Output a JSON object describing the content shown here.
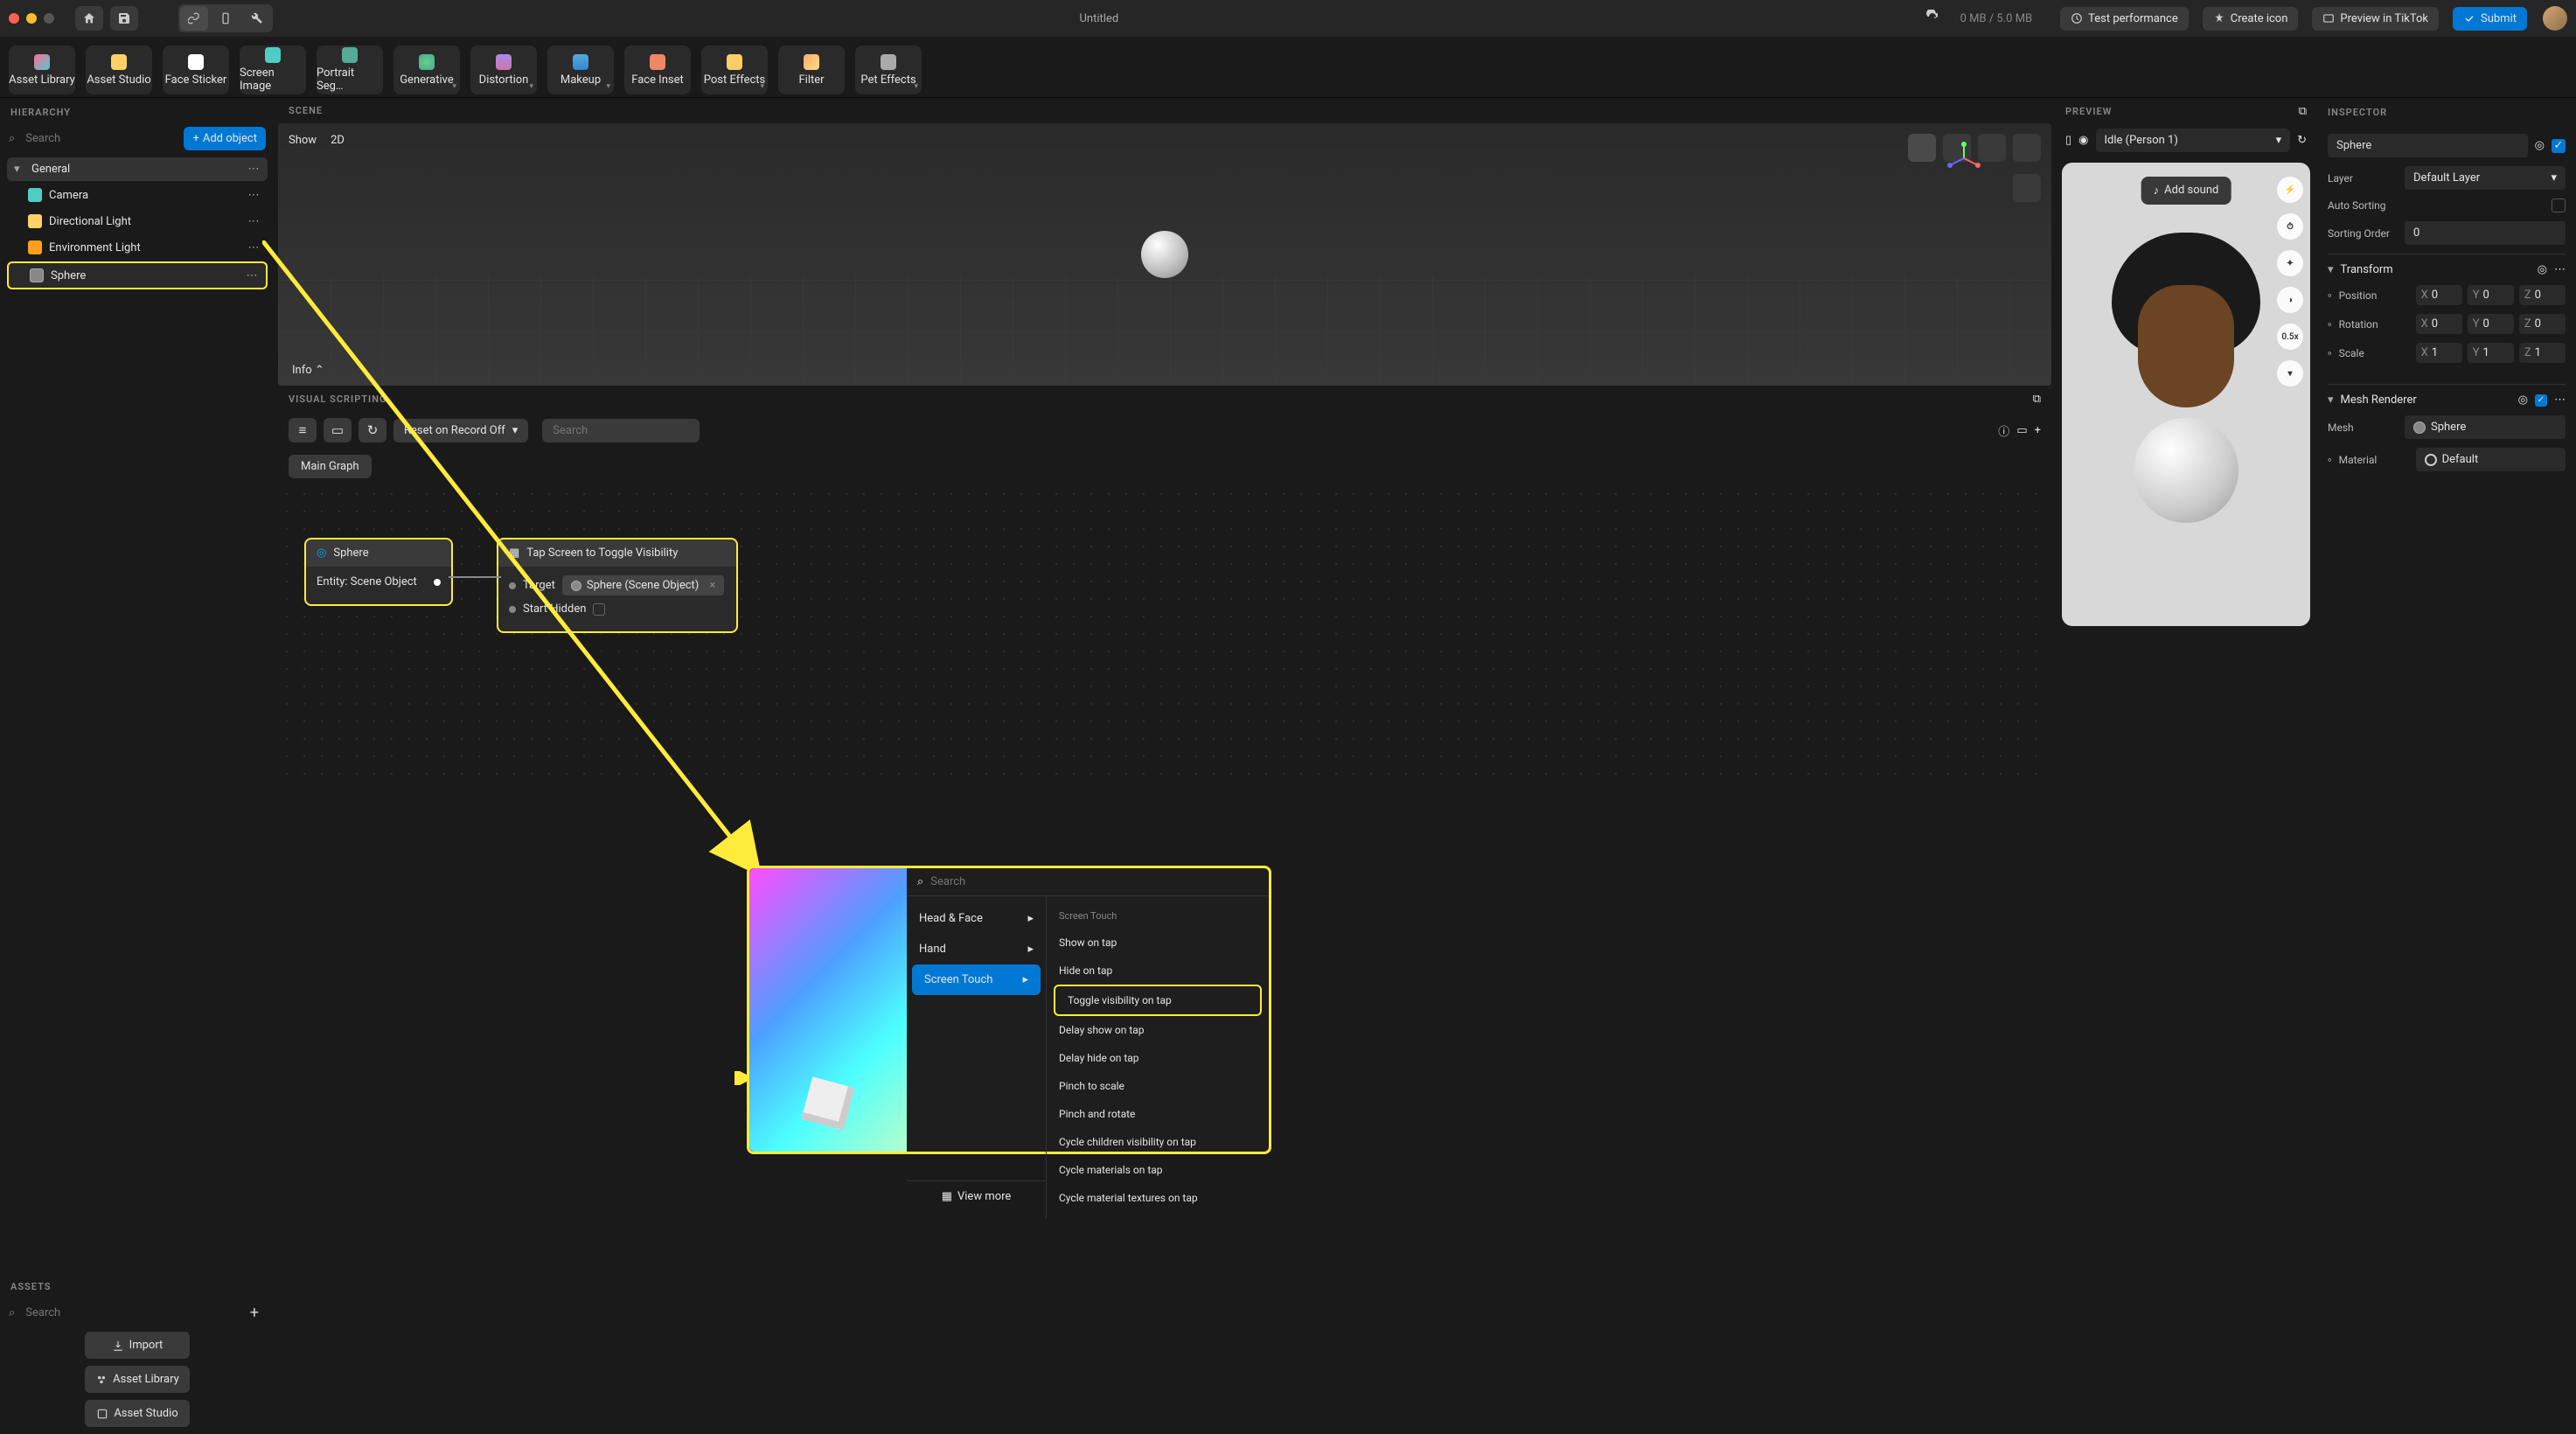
{
  "topbar": {
    "title": "Untitled",
    "size": "0 MB / 5.0 MB",
    "test_perf": "Test performance",
    "create_icon": "Create icon",
    "preview_tiktok": "Preview in TikTok",
    "submit": "Submit"
  },
  "toolbar": {
    "items": [
      "Asset Library",
      "Asset Studio",
      "Face Sticker",
      "Screen Image",
      "Portrait Seg…",
      "Generative",
      "Distortion",
      "Makeup",
      "Face Inset",
      "Post Effects",
      "Filter",
      "Pet Effects"
    ]
  },
  "hierarchy": {
    "title": "HIERARCHY",
    "search": "Search",
    "add_object": "Add object",
    "root": "General",
    "items": [
      "Camera",
      "Directional Light",
      "Environment Light",
      "Sphere"
    ]
  },
  "assets": {
    "title": "ASSETS",
    "search": "Search",
    "import": "Import",
    "library": "Asset Library",
    "studio": "Asset Studio"
  },
  "scene": {
    "title": "SCENE",
    "show": "Show",
    "mode": "2D",
    "info": "Info"
  },
  "visual_scripting": {
    "title": "VISUAL SCRIPTING",
    "reset": "Reset on Record Off",
    "search": "Search",
    "main_graph": "Main Graph",
    "node1": {
      "title": "Sphere",
      "row": "Entity: Scene Object"
    },
    "node2": {
      "title": "Tap Screen to Toggle Visibility",
      "target": "Target",
      "target_value": "Sphere (Scene Object)",
      "start_hidden": "Start Hidden"
    }
  },
  "preview": {
    "title": "PREVIEW",
    "state": "Idle (Person 1)",
    "add_sound": "Add sound",
    "speed": "0.5x"
  },
  "inspector": {
    "title": "INSPECTOR",
    "name_value": "Sphere",
    "layer": "Layer",
    "layer_value": "Default Layer",
    "auto_sorting": "Auto Sorting",
    "sorting_order": "Sorting Order",
    "sorting_order_value": "0",
    "transform": "Transform",
    "position": "Position",
    "rotation": "Rotation",
    "scale": "Scale",
    "pos": {
      "x": "0",
      "y": "0",
      "z": "0"
    },
    "rot": {
      "x": "0",
      "y": "0",
      "z": "0"
    },
    "scl": {
      "x": "1",
      "y": "1",
      "z": "1"
    },
    "mesh_renderer": "Mesh Renderer",
    "mesh": "Mesh",
    "mesh_value": "Sphere",
    "material": "Material",
    "material_value": "Default"
  },
  "popup": {
    "search": "Search",
    "categories": [
      "Head & Face",
      "Hand",
      "Screen Touch"
    ],
    "group": "Screen Touch",
    "items": [
      "Show on tap",
      "Hide on tap",
      "Toggle visibility on tap",
      "Delay show on tap",
      "Delay hide on tap",
      "Pinch to scale",
      "Pinch and rotate",
      "Cycle children visibility on tap",
      "Cycle materials on tap",
      "Cycle material textures on tap"
    ],
    "view_more": "View more"
  }
}
